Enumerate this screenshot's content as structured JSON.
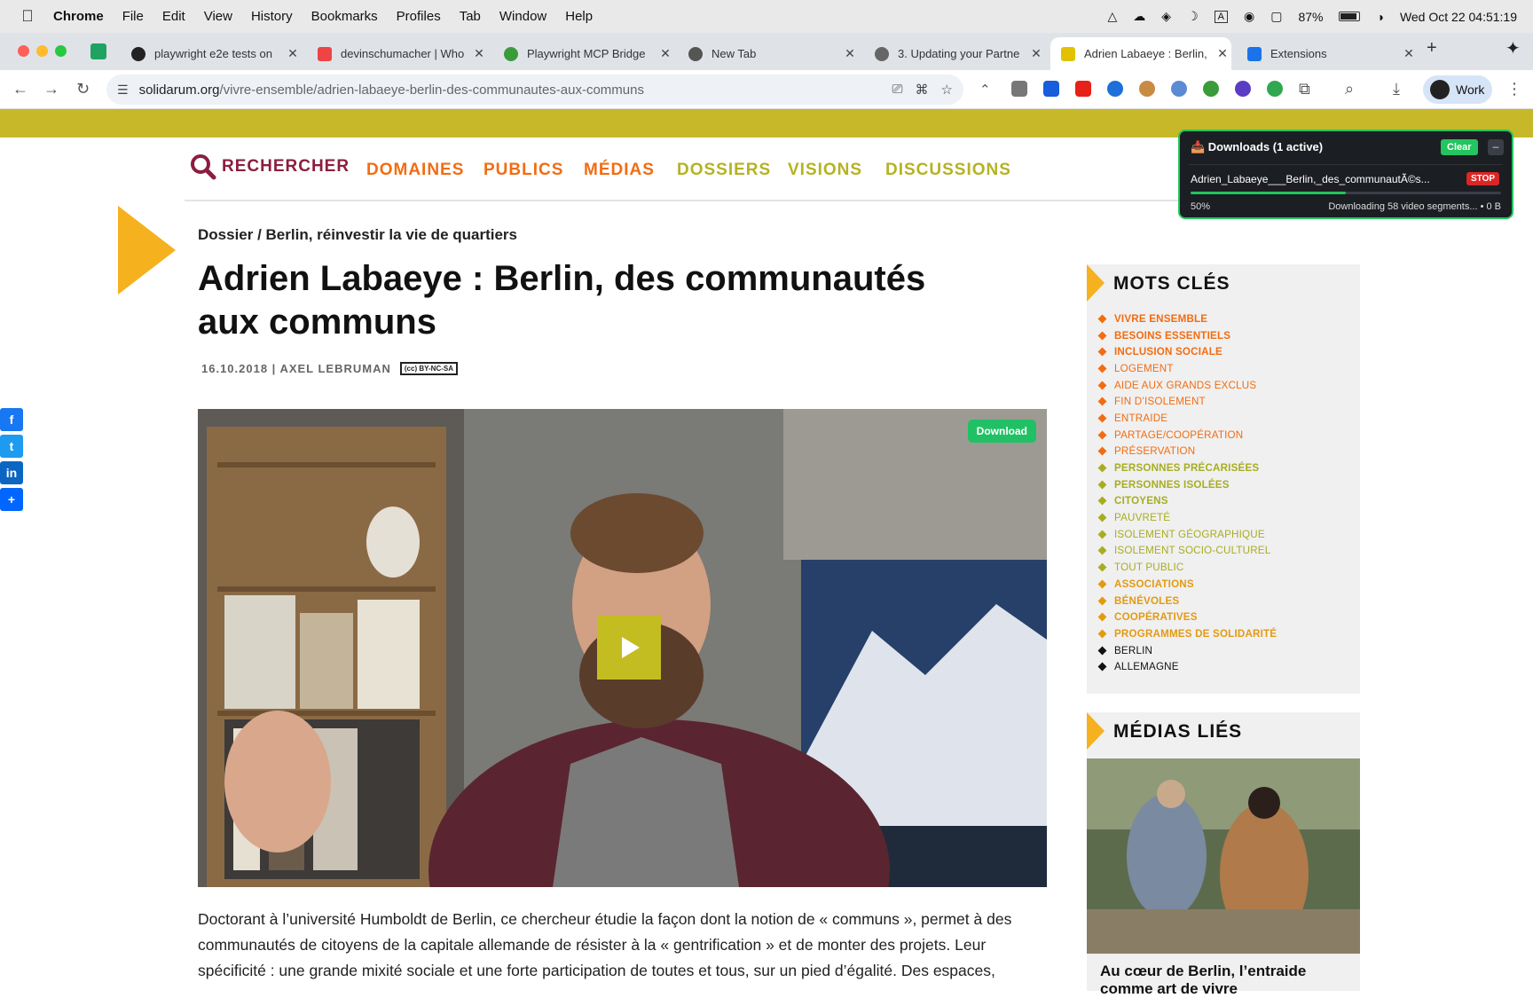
{
  "menubar": {
    "app": "Chrome",
    "items": [
      "File",
      "Edit",
      "View",
      "History",
      "Bookmarks",
      "Profiles",
      "Tab",
      "Window",
      "Help"
    ],
    "battery": "87%",
    "datetime": "Wed Oct 22  04:51:19"
  },
  "tabs": [
    {
      "title": "playwright e2e tests on"
    },
    {
      "title": "devinschumacher | Who"
    },
    {
      "title": "Playwright MCP Bridge"
    },
    {
      "title": "New Tab"
    },
    {
      "title": "3. Updating your Partne"
    },
    {
      "title": "Adrien Labaeye : Berlin,"
    },
    {
      "title": "Extensions"
    }
  ],
  "address": {
    "domain": "solidarum.org",
    "path": "/vivre-ensemble/adrien-labaeye-berlin-des-communautes-aux-communs"
  },
  "profile": {
    "label": "Work"
  },
  "sitenav": {
    "search": "RECHERCHER",
    "links": [
      "DOMAINES",
      "PUBLICS",
      "MÉDIAS",
      "DOSSIERS",
      "VISIONS",
      "DISCUSSIONS"
    ]
  },
  "article": {
    "dossier": "Dossier / Berlin, réinvestir la vie de quartiers",
    "title": "Adrien Labaeye : Berlin, des communautés aux communs",
    "meta": "16.10.2018 | AXEL LEBRUMAN",
    "license": "(cc) BY-NC-SA",
    "video_download": "Download",
    "body": "Doctorant à l’université Humboldt de Berlin, ce chercheur étudie la façon dont la notion de  « communs », permet à des communautés de citoyens de la capitale allemande de résister à la « gentrification » et de monter des projets. Leur spécificité : une grande mixité sociale et une forte participation de toutes et tous, sur un pied d’égalité. Des espaces,"
  },
  "keywords": {
    "heading": "MOTS CLÉS",
    "items": [
      {
        "label": "VIVRE ENSEMBLE",
        "color": "#f26c12",
        "bold": true
      },
      {
        "label": "BESOINS ESSENTIELS",
        "color": "#f26c12",
        "bold": true
      },
      {
        "label": "INCLUSION SOCIALE",
        "color": "#f26c12",
        "bold": true
      },
      {
        "label": "LOGEMENT",
        "color": "#f26c12",
        "bold": false
      },
      {
        "label": "AIDE AUX GRANDS EXCLUS",
        "color": "#f26c12",
        "bold": false
      },
      {
        "label": "FIN D’ISOLEMENT",
        "color": "#f26c12",
        "bold": false
      },
      {
        "label": "ENTRAIDE",
        "color": "#f26c12",
        "bold": false
      },
      {
        "label": "PARTAGE/COOPÉRATION",
        "color": "#f26c12",
        "bold": false
      },
      {
        "label": "PRÉSERVATION",
        "color": "#f26c12",
        "bold": false
      },
      {
        "label": "PERSONNES PRÉCARISÉES",
        "color": "#a7ad21",
        "bold": true
      },
      {
        "label": "PERSONNES ISOLÉES",
        "color": "#a7ad21",
        "bold": true
      },
      {
        "label": "CITOYENS",
        "color": "#a7ad21",
        "bold": true
      },
      {
        "label": "PAUVRETÉ",
        "color": "#a7ad21",
        "bold": false
      },
      {
        "label": "ISOLEMENT GÉOGRAPHIQUE",
        "color": "#a7ad21",
        "bold": false
      },
      {
        "label": "ISOLEMENT SOCIO-CULTUREL",
        "color": "#a7ad21",
        "bold": false
      },
      {
        "label": "TOUT PUBLIC",
        "color": "#a7ad21",
        "bold": false
      },
      {
        "label": "ASSOCIATIONS",
        "color": "#e39a12",
        "bold": true
      },
      {
        "label": "BÉNÉVOLES",
        "color": "#e39a12",
        "bold": true
      },
      {
        "label": "COOPÉRATIVES",
        "color": "#e39a12",
        "bold": true
      },
      {
        "label": "PROGRAMMES DE SOLIDARITÉ",
        "color": "#e39a12",
        "bold": true
      },
      {
        "label": "BERLIN",
        "color": "#111111",
        "bold": false
      },
      {
        "label": "ALLEMAGNE",
        "color": "#111111",
        "bold": false
      }
    ]
  },
  "medias": {
    "heading": "MÉDIAS LIÉS",
    "caption": "Au cœur de Berlin, l’entraide comme art de vivre"
  },
  "downloads": {
    "header": "📥 Downloads (1 active)",
    "clear": "Clear",
    "minimize": "–",
    "file": "Adrien_Labaeye___Berlin,_des_communautÃ©s...",
    "stop": "STOP",
    "progress": 0.5,
    "percent": "50%",
    "status": "Downloading 58 video segments... • 0 B"
  }
}
